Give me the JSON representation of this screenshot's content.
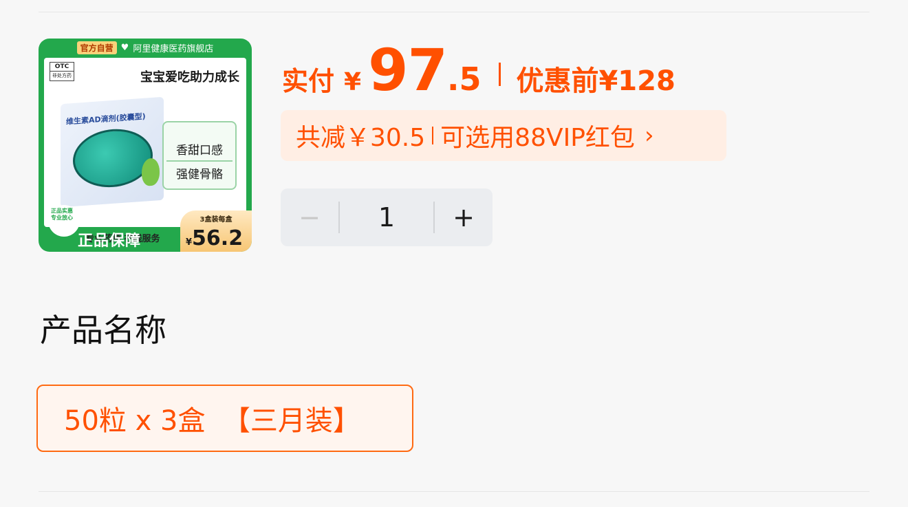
{
  "image": {
    "banner_tag": "官方自营",
    "banner_store": "阿里健康医药旗舰店",
    "otc_label": "OTC",
    "otc_sub": "非处方药",
    "slogan": "宝宝爱吃助力成长",
    "box_name": "维生素AD滴剂(胶囊型)",
    "features": [
      "香甜口感",
      "强健骨骼"
    ],
    "seal_text": "正品实惠 专业放心",
    "service": "专业药师 在线服务",
    "guarantee": "正品保障",
    "unit_label": "3盒装每盒",
    "unit_currency": "¥",
    "unit_price": "56.2"
  },
  "price": {
    "label": "实付",
    "currency": "¥",
    "integer": "97",
    "decimal": ".5",
    "before_label": "优惠前",
    "before_value": "¥128"
  },
  "discount": {
    "saved": "共减￥30.5",
    "coupon": "可选用88VIP红包",
    "chevron": "›"
  },
  "stepper": {
    "minus": "−",
    "quantity": "1",
    "plus": "+"
  },
  "section": {
    "title": "产品名称"
  },
  "option": {
    "label": "50粒 x 3盒  【三月装】"
  },
  "colors": {
    "accent": "#ff5000",
    "discount_bg": "#ffeee4",
    "brand_green": "#23a84c"
  }
}
